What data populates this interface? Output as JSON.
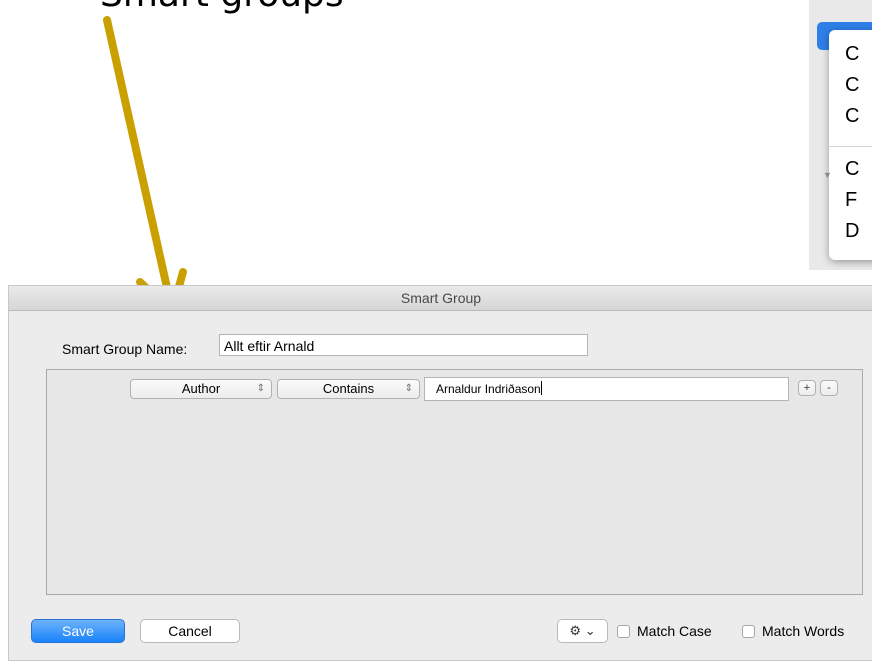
{
  "caption": {
    "text": "Smart groups"
  },
  "context_menu": {
    "items": [
      "C",
      "C",
      "C",
      "C",
      "F",
      "D"
    ]
  },
  "dialog": {
    "title": "Smart Group",
    "name_label": "Smart Group Name:",
    "name_value": "Allt eftir Arnald",
    "criteria": {
      "field": "Author",
      "operator": "Contains",
      "value": "Arnaldur Indriðason",
      "add": "+",
      "remove": "-"
    },
    "buttons": {
      "save": "Save",
      "cancel": "Cancel",
      "gear_chevron": "⌄"
    },
    "options": {
      "match_case": {
        "label": "Match Case",
        "checked": false
      },
      "match_words": {
        "label": "Match Words",
        "checked": false
      }
    }
  },
  "colors": {
    "arrow": "#C9A000",
    "save_button": "#1A82FB",
    "dialog_bg": "#ECECEC"
  }
}
